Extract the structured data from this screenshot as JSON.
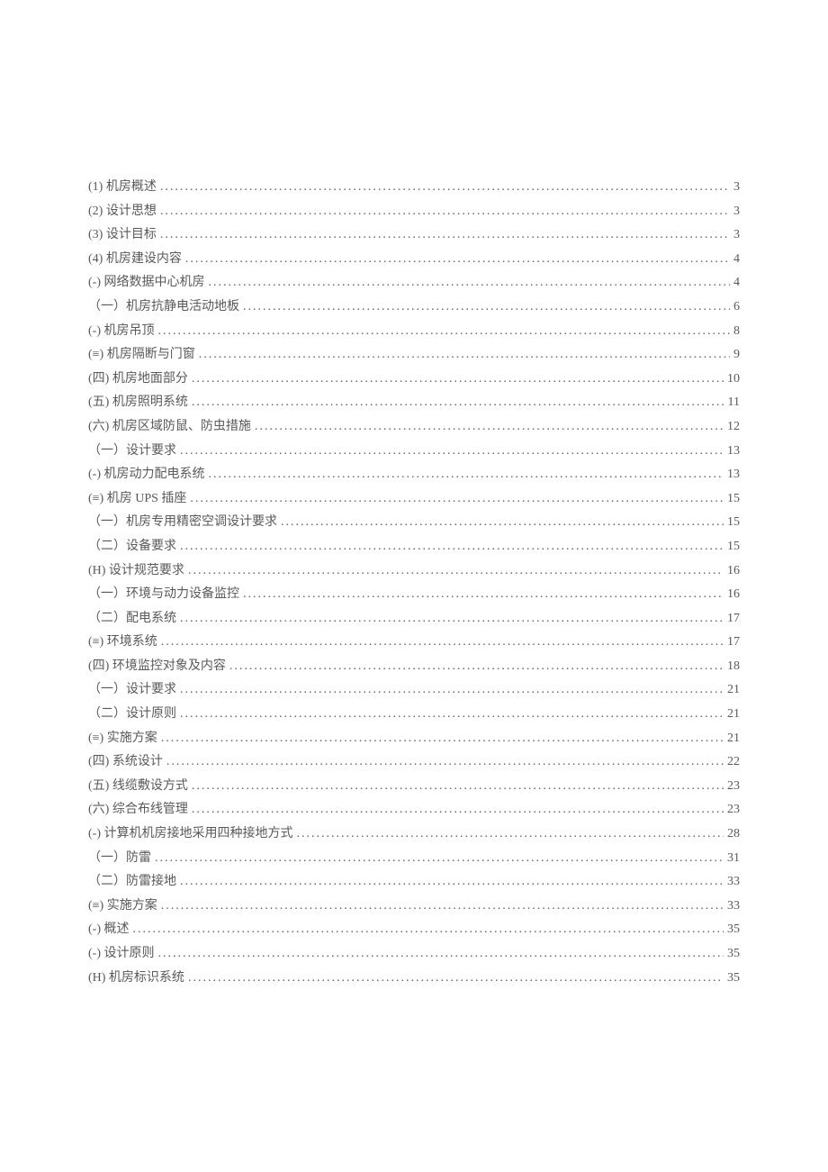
{
  "toc": [
    {
      "label": "(1) 机房概述",
      "page": "3"
    },
    {
      "label": "(2) 设计思想",
      "page": "3"
    },
    {
      "label": "(3) 设计目标",
      "page": "3"
    },
    {
      "label": "(4) 机房建设内容",
      "page": "4"
    },
    {
      "label": "(-) 网络数据中心机房",
      "page": "4"
    },
    {
      "label": "（一）机房抗静电活动地板",
      "page": "6"
    },
    {
      "label": "(-) 机房吊顶",
      "page": "8"
    },
    {
      "label": "(≡) 机房隔断与门窗",
      "page": "9"
    },
    {
      "label": "(四) 机房地面部分",
      "page": "10"
    },
    {
      "label": "(五) 机房照明系统",
      "page": "11"
    },
    {
      "label": "(六) 机房区域防鼠、防虫措施",
      "page": "12"
    },
    {
      "label": "（一）设计要求",
      "page": "13"
    },
    {
      "label": "(-) 机房动力配电系统",
      "page": "13"
    },
    {
      "label": "(≡) 机房 UPS 插座",
      "page": "15"
    },
    {
      "label": "（一）机房专用精密空调设计要求",
      "page": "15"
    },
    {
      "label": "（二）设备要求",
      "page": "15"
    },
    {
      "label": "(H) 设计规范要求",
      "page": "16"
    },
    {
      "label": "（一）环境与动力设备监控",
      "page": "16"
    },
    {
      "label": "（二）配电系统",
      "page": "17"
    },
    {
      "label": "(≡) 环境系统",
      "page": "17"
    },
    {
      "label": "(四) 环境监控对象及内容",
      "page": "18"
    },
    {
      "label": "（一）设计要求",
      "page": "21"
    },
    {
      "label": "（二）设计原则",
      "page": "21"
    },
    {
      "label": "(≡) 实施方案",
      "page": "21"
    },
    {
      "label": "(四) 系统设计",
      "page": "22"
    },
    {
      "label": "(五) 线缆敷设方式",
      "page": "23"
    },
    {
      "label": "(六) 综合布线管理",
      "page": "23"
    },
    {
      "label": "(-) 计算机机房接地采用四种接地方式",
      "page": "28"
    },
    {
      "label": "（一）防雷",
      "page": "31"
    },
    {
      "label": "（二）防雷接地",
      "page": "33"
    },
    {
      "label": "(≡) 实施方案",
      "page": "33"
    },
    {
      "label": "(-) 概述",
      "page": "35"
    },
    {
      "label": "(-) 设计原则",
      "page": "35"
    },
    {
      "label": "(H) 机房标识系统",
      "page": "35"
    }
  ]
}
